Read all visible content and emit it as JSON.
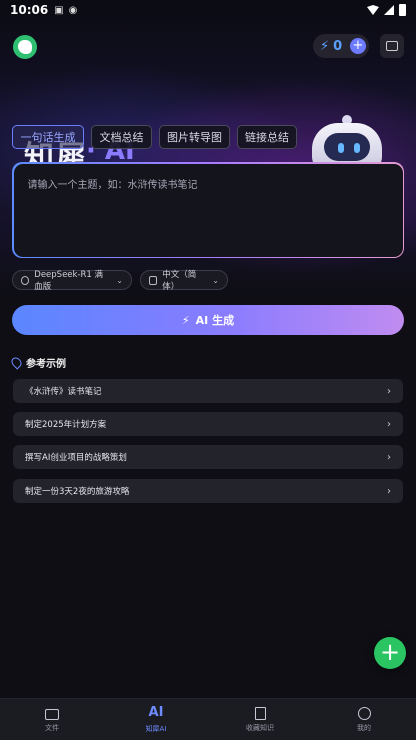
{
  "status_bar": {
    "time": "10:06"
  },
  "header": {
    "credits": "0"
  },
  "hero": {
    "title": "知犀",
    "ai": "· AI"
  },
  "tabs": [
    {
      "label": "一句话生成",
      "active": true
    },
    {
      "label": "文档总结",
      "active": false
    },
    {
      "label": "图片转导图",
      "active": false
    },
    {
      "label": "链接总结",
      "active": false
    }
  ],
  "prompt": {
    "placeholder": "请输入一个主题，如：水浒传读书笔记"
  },
  "model_select": {
    "value": "DeepSeek-R1 满血版"
  },
  "language_select": {
    "value": "中文（简体）"
  },
  "generate_button": {
    "icon": "bolt-icon",
    "label": "AI 生成"
  },
  "examples": {
    "header": "参考示例",
    "items": [
      "《水浒传》读书笔记",
      "制定2025年计划方案",
      "撰写AI创业项目的战略策划",
      "制定一份3天2夜的旅游攻略"
    ]
  },
  "bottom_nav": [
    {
      "label": "文件",
      "icon": "folder-icon",
      "active": false
    },
    {
      "label": "知犀AI",
      "icon": "ai-icon",
      "glyph": "AI",
      "active": true
    },
    {
      "label": "收藏知识",
      "icon": "bookmark-icon",
      "active": false
    },
    {
      "label": "我的",
      "icon": "profile-icon",
      "active": false
    }
  ],
  "colors": {
    "accent": "#6d8bff",
    "fab": "#2bc462",
    "background": "#0e0e14"
  }
}
